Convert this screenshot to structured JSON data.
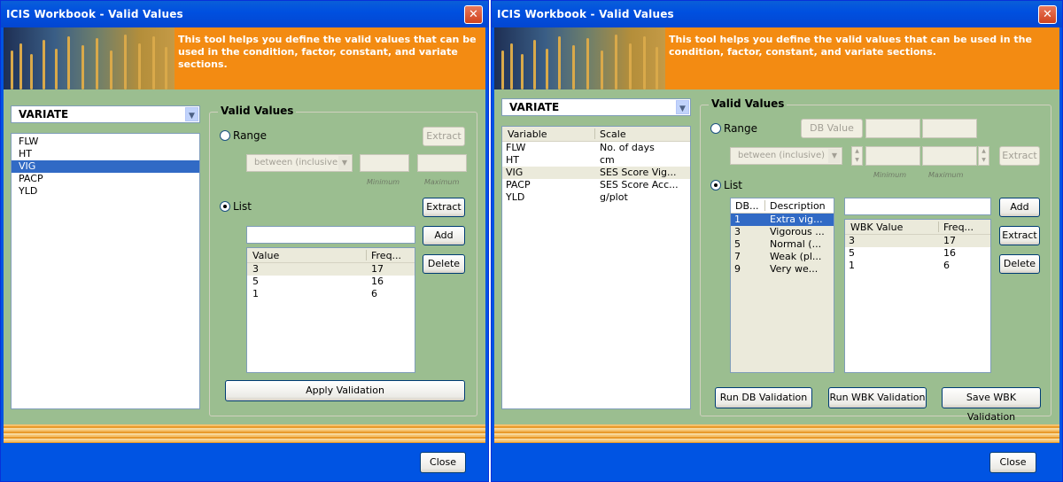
{
  "left": {
    "title": "ICIS Workbook - Valid Values",
    "banner_text": "This tool helps you define the valid values that can be used in the condition, factor, constant, and variate sections.",
    "section_select": "VARIATE",
    "variables": [
      "FLW",
      "HT",
      "VIG",
      "PACP",
      "YLD"
    ],
    "selected_variable": "VIG",
    "group_label": "Valid Values",
    "range_label": "Range",
    "list_label": "List",
    "range_operator": "between (inclusive)",
    "min_label": "Minimum",
    "max_label": "Maximum",
    "extract_label": "Extract",
    "add_label": "Add",
    "delete_label": "Delete",
    "table_headers": [
      "Value",
      "Freq..."
    ],
    "table_rows": [
      [
        "3",
        "17"
      ],
      [
        "5",
        "16"
      ],
      [
        "1",
        "6"
      ]
    ],
    "apply_label": "Apply Validation",
    "close_label": "Close"
  },
  "right": {
    "title": "ICIS Workbook - Valid Values",
    "banner_text": "This tool helps you define the valid values that can be used in the condition, factor, constant, and variate sections.",
    "section_select": "VARIATE",
    "var_headers": [
      "Variable",
      "Scale"
    ],
    "var_rows": [
      [
        "FLW",
        "No. of days"
      ],
      [
        "HT",
        "cm"
      ],
      [
        "VIG",
        "SES Score Vig..."
      ],
      [
        "PACP",
        "SES Score Acc..."
      ],
      [
        "YLD",
        "g/plot"
      ]
    ],
    "group_label": "Valid Values",
    "range_label": "Range",
    "list_label": "List",
    "db_value_label": "DB Value",
    "range_operator": "between (inclusive)",
    "min_label": "Minimum",
    "max_label": "Maximum",
    "extract_label": "Extract",
    "add_label": "Add",
    "delete_label": "Delete",
    "db_headers": [
      "DB...",
      "Description"
    ],
    "db_rows": [
      [
        "1",
        "Extra vig..."
      ],
      [
        "3",
        "Vigorous ..."
      ],
      [
        "5",
        "Normal (..."
      ],
      [
        "7",
        "Weak (pl..."
      ],
      [
        "9",
        "Very we..."
      ]
    ],
    "wbk_headers": [
      "WBK Value",
      "Freq..."
    ],
    "wbk_rows": [
      [
        "3",
        "17"
      ],
      [
        "5",
        "16"
      ],
      [
        "1",
        "6"
      ]
    ],
    "run_db_label": "Run DB Validation",
    "run_wbk_label": "Run WBK Validation",
    "save_wbk_label": "Save WBK Validation",
    "close_label": "Close"
  }
}
